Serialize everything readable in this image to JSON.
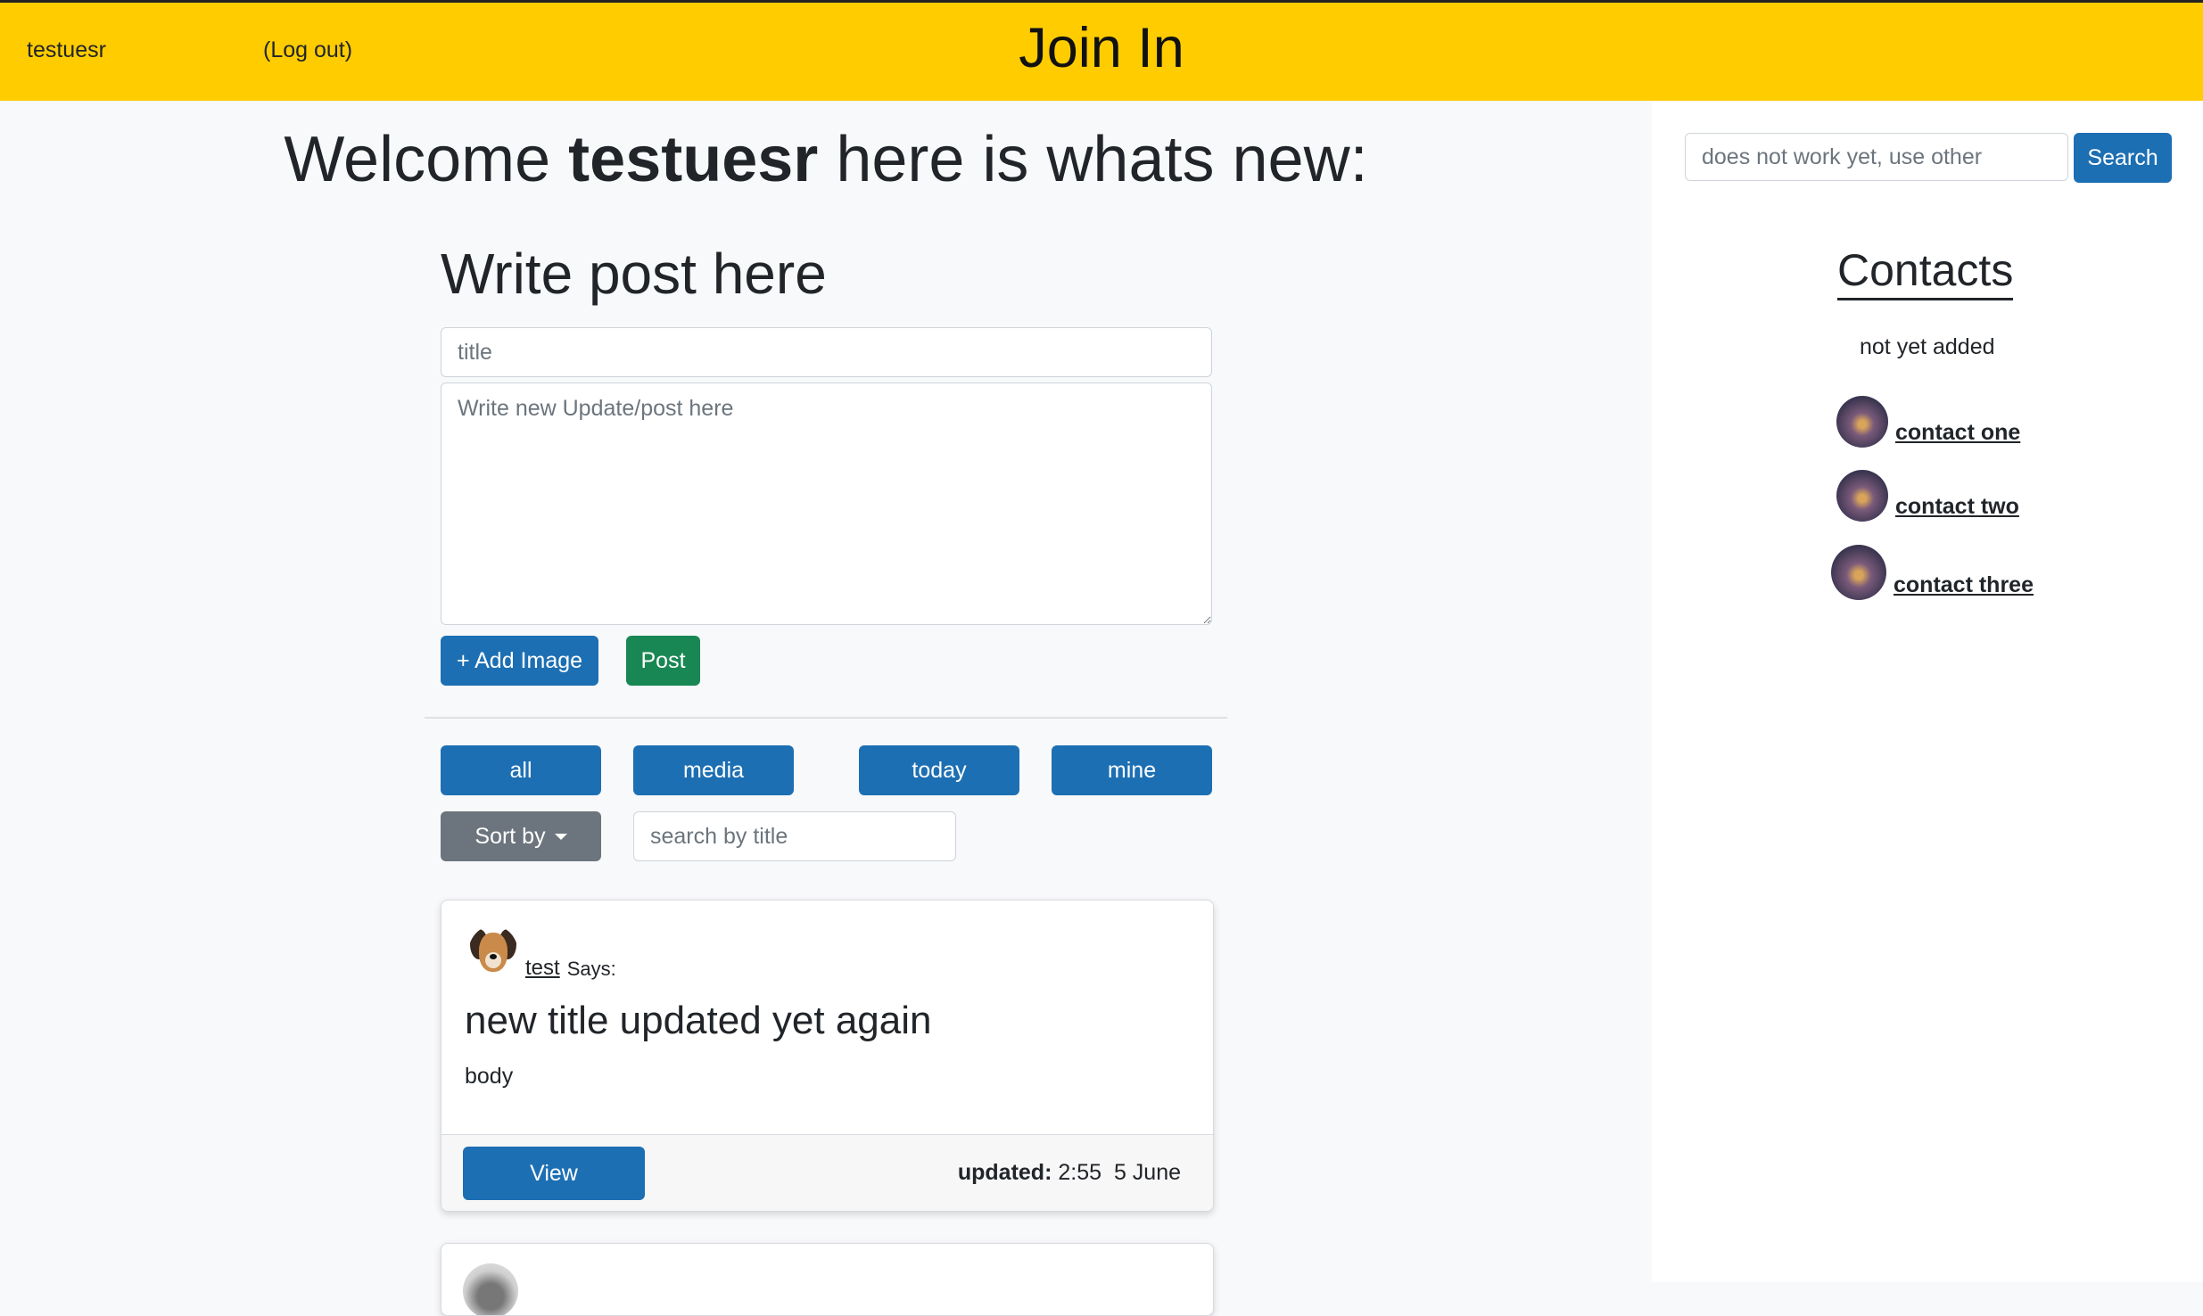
{
  "header": {
    "username": "testuesr",
    "logout_label": "(Log out)",
    "brand": "Join In"
  },
  "welcome": {
    "prefix": "Welcome",
    "username": "testuesr",
    "suffix": "here is whats new:"
  },
  "composer": {
    "heading": "Write post here",
    "title_placeholder": "title",
    "body_placeholder": "Write new Update/post here",
    "add_image_label": "+ Add Image",
    "post_label": "Post"
  },
  "filters": {
    "buttons": [
      "all",
      "media",
      "today",
      "mine"
    ],
    "sort_label": "Sort by",
    "title_search_placeholder": "search by title"
  },
  "sidebar": {
    "search_placeholder": "does not work yet, use other",
    "search_label": "Search",
    "contacts_title": "Contacts",
    "contacts_note": "not yet added",
    "contacts": [
      "contact one",
      "contact two",
      "contact three"
    ]
  },
  "posts": [
    {
      "author": "test",
      "says": "Says:",
      "title": "new title updated yet again",
      "body": "body",
      "view_label": "View",
      "updated_label": "updated:",
      "updated_time": "2:55",
      "updated_date": "5 June"
    }
  ],
  "colors": {
    "header_bg": "#ffcc00",
    "primary": "#1d6fb3",
    "success": "#198754",
    "secondary": "#6c757d"
  }
}
